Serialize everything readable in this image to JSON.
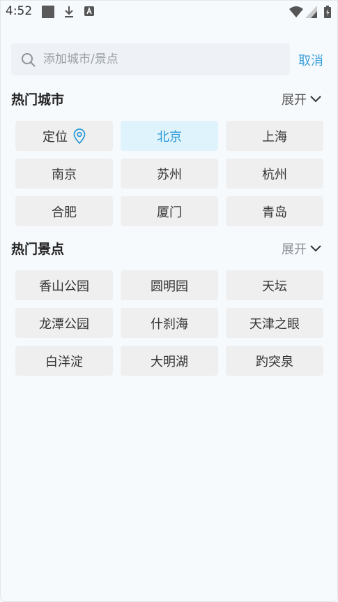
{
  "status_bar": {
    "time": "4:52"
  },
  "search": {
    "placeholder": "添加城市/景点",
    "value": "",
    "cancel_label": "取消"
  },
  "hot_cities": {
    "title": "热门城市",
    "expand_label": "展开",
    "items": [
      "定位",
      "北京",
      "上海",
      "南京",
      "苏州",
      "杭州",
      "合肥",
      "厦门",
      "青岛"
    ]
  },
  "hot_spots": {
    "title": "热门景点",
    "expand_label": "展开",
    "items": [
      "香山公园",
      "圆明园",
      "天坛",
      "龙潭公园",
      "什刹海",
      "天津之眼",
      "白洋淀",
      "大明湖",
      "趵突泉"
    ]
  },
  "colors": {
    "accent": "#3aa0d8",
    "chip_bg": "#efefef",
    "chip_active_bg": "#dff3fc"
  }
}
